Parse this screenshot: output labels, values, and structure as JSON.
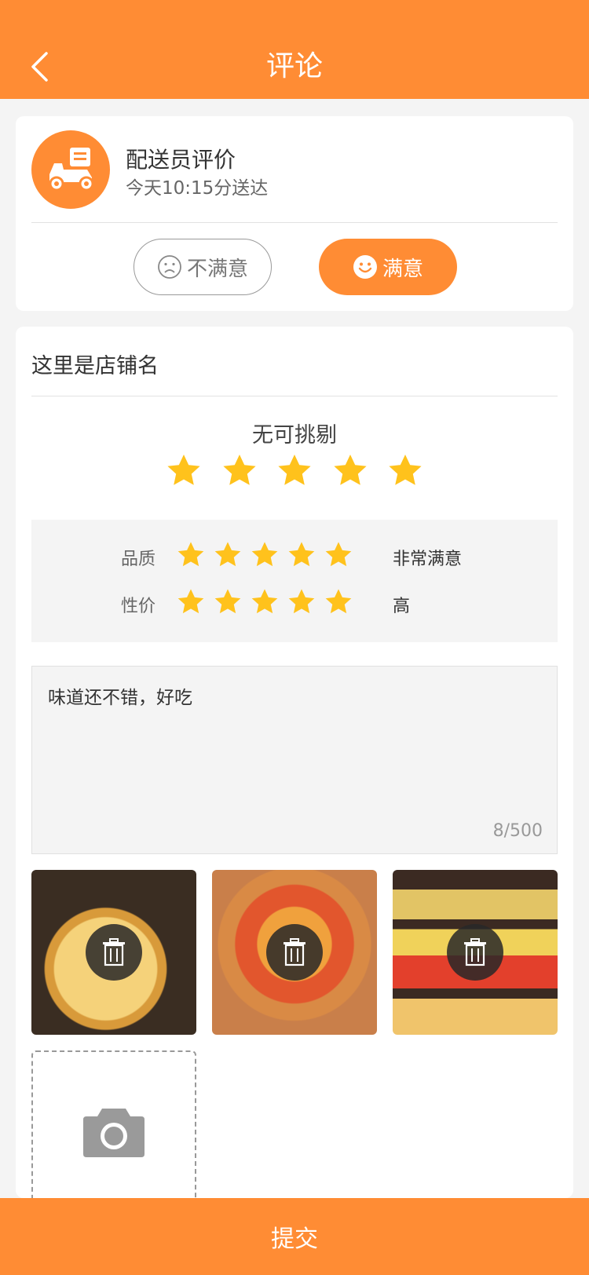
{
  "header": {
    "title": "评论",
    "back_icon": "chevron-left-icon"
  },
  "rider": {
    "title": "配送员评价",
    "delivery_time": "今天10:15分送达",
    "options": [
      {
        "label": "不满意",
        "icon": "sad-face-icon",
        "selected": false
      },
      {
        "label": "满意",
        "icon": "smile-face-icon",
        "selected": true
      }
    ]
  },
  "shop": {
    "name": "这里是店铺名",
    "overall_label": "无可挑剔",
    "overall_stars": 5,
    "ratings": [
      {
        "label": "品质",
        "stars": 5,
        "value": "非常满意"
      },
      {
        "label": "性价",
        "stars": 5,
        "value": "高"
      }
    ],
    "comment": {
      "text": "味道还不错，好吃",
      "count": "8/500"
    },
    "photos": [
      {
        "subject": "durian pizza photo"
      },
      {
        "subject": "pepperoni pizza photo"
      },
      {
        "subject": "pizza pans photo"
      }
    ]
  },
  "submit_label": "提交",
  "colors": {
    "accent": "#ff8c34",
    "star": "#ffc21c",
    "background": "#f4f4f4"
  }
}
